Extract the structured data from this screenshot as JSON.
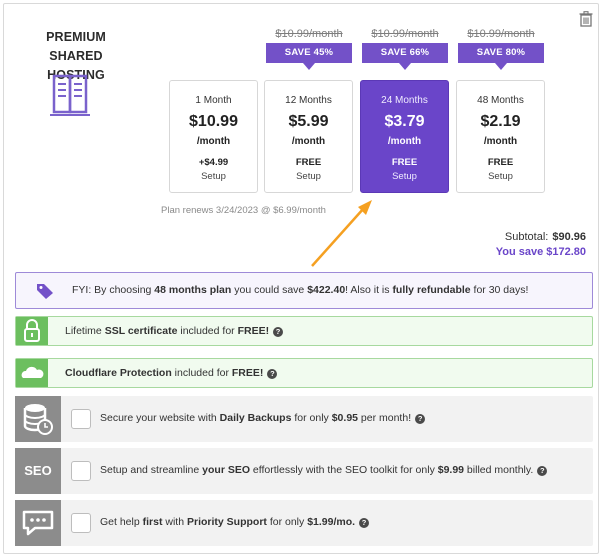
{
  "product": {
    "title_line1": "PREMIUM SHARED",
    "title_line2": "HOSTING",
    "icon": "server-icon"
  },
  "plans": [
    {
      "old_price": "",
      "badge": "",
      "duration": "1 Month",
      "price": "$10.99",
      "per": "/month",
      "setup_line1": "+$4.99",
      "setup_line2": "Setup",
      "selected": false
    },
    {
      "old_price": "$10.99/month",
      "badge": "SAVE 45%",
      "duration": "12 Months",
      "price": "$5.99",
      "per": "/month",
      "setup_line1": "FREE",
      "setup_line2": "Setup",
      "selected": false
    },
    {
      "old_price": "$10.99/month",
      "badge": "SAVE 66%",
      "duration": "24 Months",
      "price": "$3.79",
      "per": "/month",
      "setup_line1": "FREE",
      "setup_line2": "Setup",
      "selected": true
    },
    {
      "old_price": "$10.99/month",
      "badge": "SAVE 80%",
      "duration": "48 Months",
      "price": "$2.19",
      "per": "/month",
      "setup_line1": "FREE",
      "setup_line2": "Setup",
      "selected": false
    }
  ],
  "renews_text": "Plan renews 3/24/2023 @ $6.99/month",
  "summary": {
    "subtotal_label": "Subtotal:",
    "subtotal_value": "$90.96",
    "save_label": "You save",
    "save_value": "$172.80"
  },
  "fyi": {
    "t1": "FYI: By choosing ",
    "b1": "48 months plan",
    "t2": " you could save ",
    "b2": "$422.40",
    "t3": "! Also it is ",
    "b3": "fully refundable",
    "t4": " for 30 days!"
  },
  "features": [
    {
      "icon": "lock-icon",
      "t1": "Lifetime ",
      "b1": "SSL certificate",
      "t2": " included for ",
      "b2": "FREE!"
    },
    {
      "icon": "cloud-icon",
      "t1": "",
      "b1": "Cloudflare Protection",
      "t2": " included for ",
      "b2": "FREE!"
    }
  ],
  "addons": [
    {
      "icon": "backup-database-icon",
      "t1": "Secure your website with ",
      "b1": "Daily Backups",
      "t2": " for only ",
      "b2": "$0.95",
      "t3": " per month!",
      "icon_text": ""
    },
    {
      "icon": "seo-icon",
      "t1": "Setup and streamline ",
      "b1": "your SEO",
      "t2": " effortlessly with the SEO toolkit for only ",
      "b2": "$9.99",
      "t3": " billed monthly.",
      "icon_text": "SEO"
    },
    {
      "icon": "support-chat-icon",
      "t1": "Get help ",
      "b1": "first",
      "t2": " with ",
      "b2": "Priority Support",
      "t3": " for only ",
      "b3": "$1.99/mo.",
      "icon_text": ""
    }
  ],
  "help_glyph": "?",
  "colors": {
    "accent": "#6a45c9",
    "badge": "#7351c8",
    "feature_green": "#6cbf5f",
    "addon_gray": "#8c8c8c",
    "arrow": "#f5a021"
  }
}
